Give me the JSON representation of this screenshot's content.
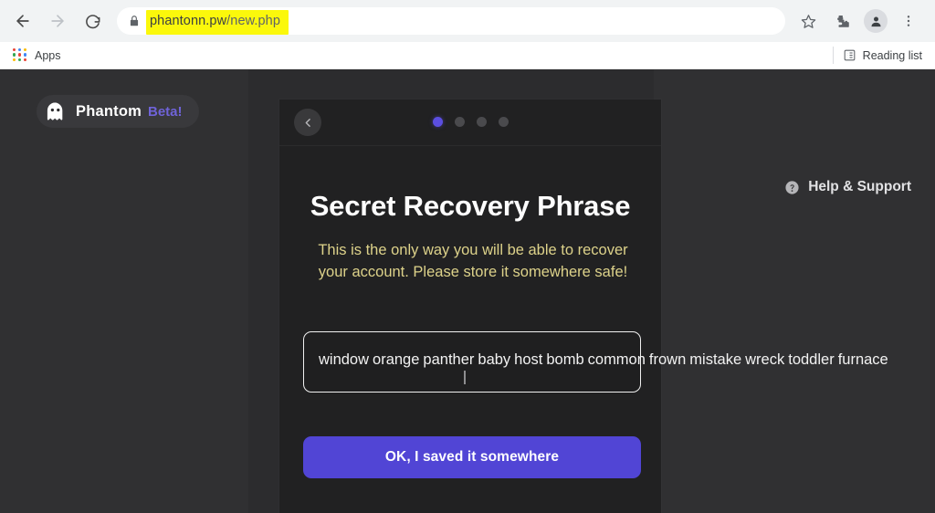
{
  "browser": {
    "nav": {
      "back_label": "Back",
      "forward_label": "Forward",
      "reload_label": "Reload"
    },
    "omnibox": {
      "lock_icon": "lock-icon",
      "url_domain": "phantonn.pw",
      "url_path": "/new.php",
      "full_url": "phantonn.pw/new.php",
      "highlight_color": "#fbf80b"
    },
    "toolbar_icons": {
      "bookmark": "star-icon",
      "extensions": "puzzle-icon",
      "profile": "avatar-icon",
      "menu": "three-dot-menu-icon"
    },
    "bookmarks_bar": {
      "apps_label": "Apps",
      "reading_list_label": "Reading list"
    }
  },
  "page": {
    "logo": {
      "name": "Phantom",
      "beta": "Beta!",
      "icon": "ghost-icon",
      "beta_color": "#6f63d8"
    },
    "help": {
      "label": "Help & Support",
      "icon": "question-circle-icon"
    },
    "card": {
      "back_button_label": "Back",
      "pagination": {
        "total": 4,
        "active_index": 0,
        "active_color": "#5b4ee0",
        "inactive_color": "#4a4a4d"
      },
      "title": "Secret Recovery Phrase",
      "warning": "This is the only way you will be able to recover your account. Please store it somewhere safe!",
      "warning_color": "#ddd28a",
      "seed_words": [
        "window",
        "orange",
        "panther",
        "baby",
        "host",
        "bomb",
        "common",
        "frown",
        "mistake",
        "wreck",
        "toddler",
        "furnace"
      ],
      "confirm_button_label": "OK, I saved it somewhere",
      "confirm_button_color": "#5145d5"
    }
  }
}
